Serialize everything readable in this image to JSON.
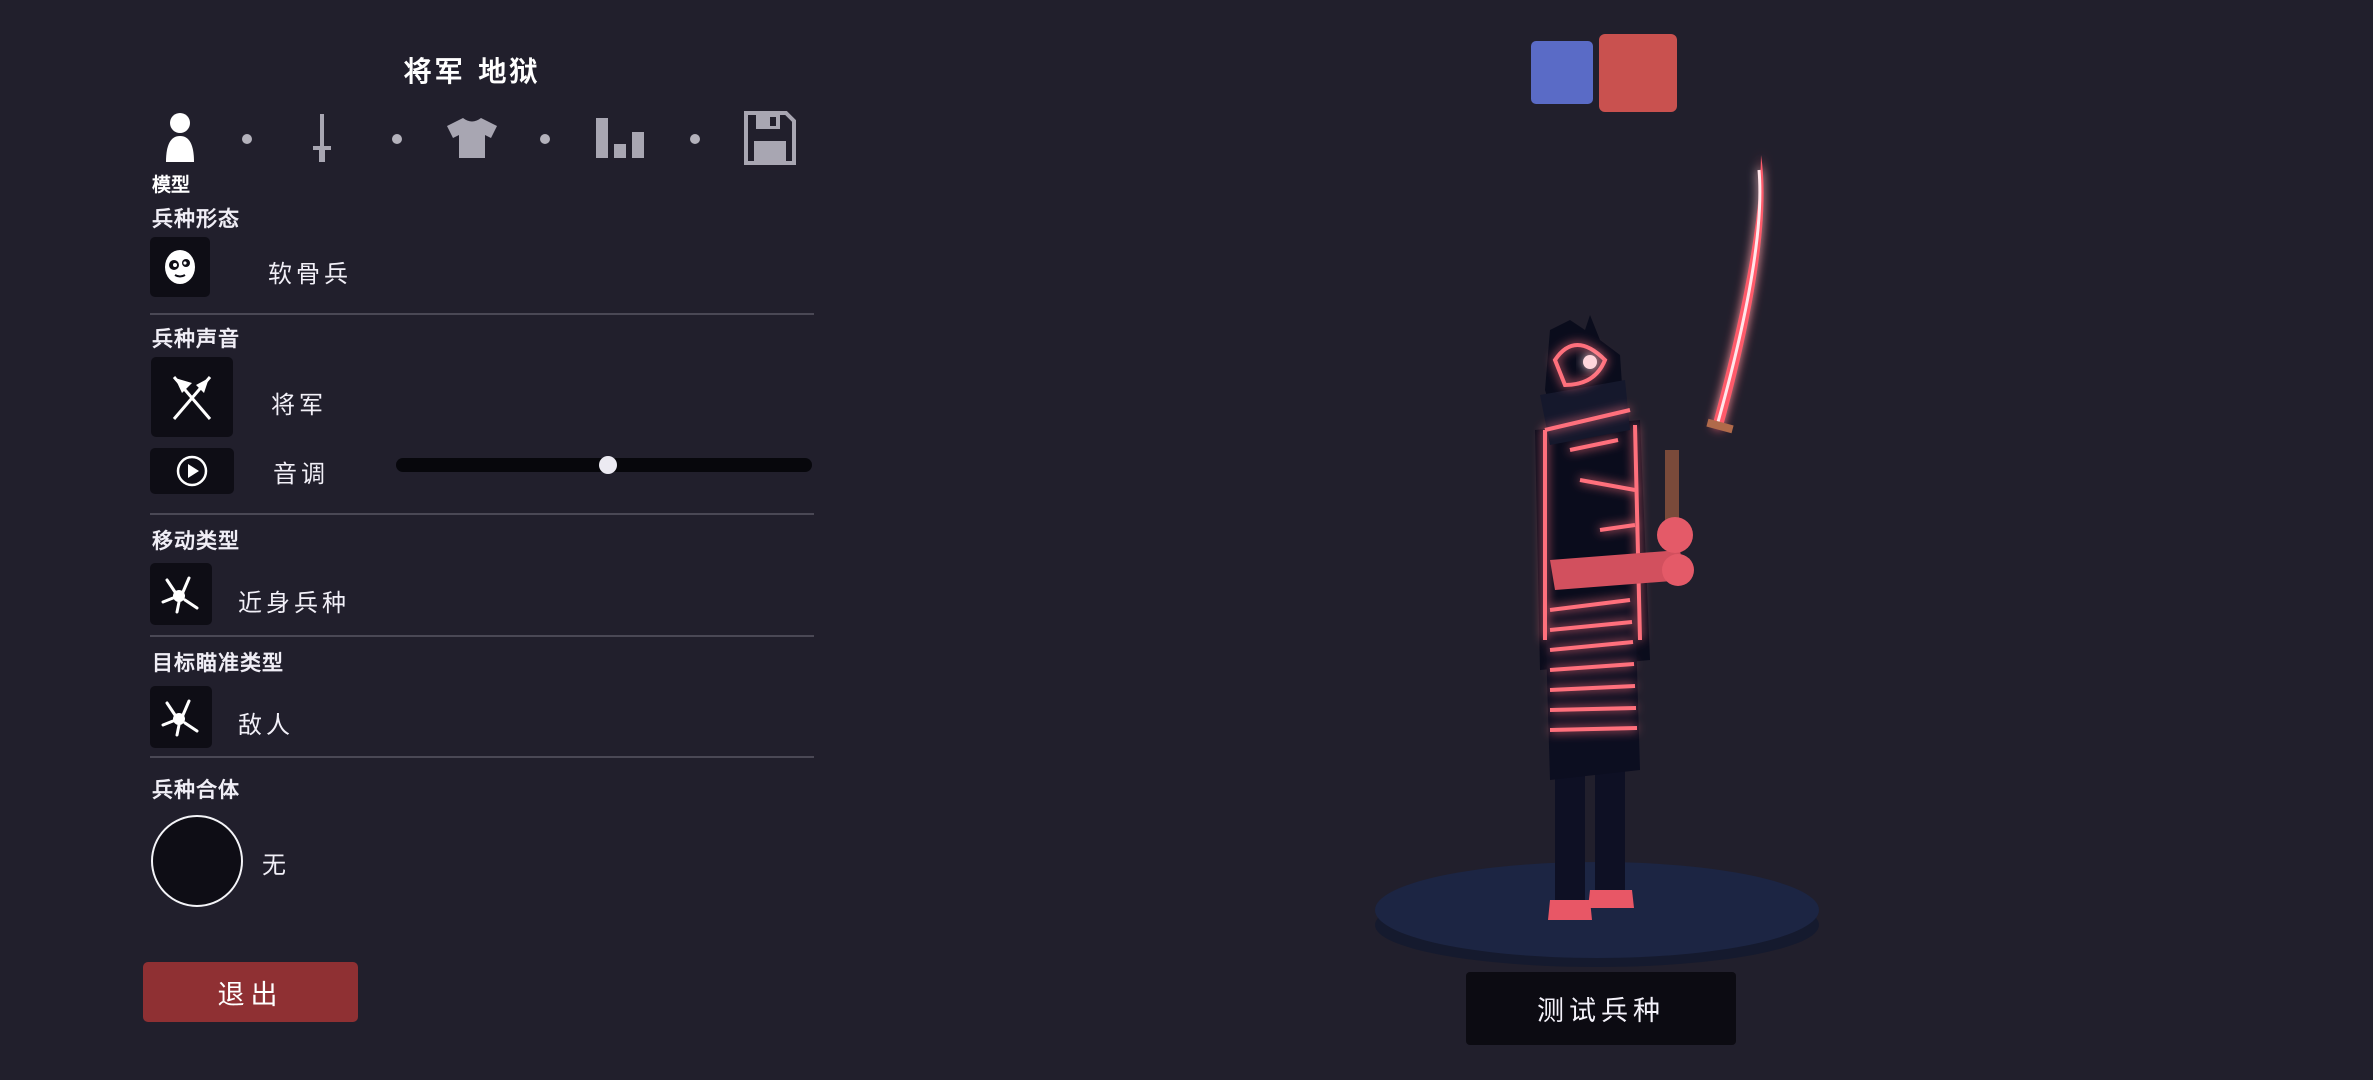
{
  "header": {
    "title": "将军 地狱"
  },
  "tabs": {
    "items": [
      {
        "icon": "person-icon",
        "active": true
      },
      {
        "icon": "sword-icon",
        "active": false
      },
      {
        "icon": "shirt-icon",
        "active": false
      },
      {
        "icon": "stats-bars-icon",
        "active": false
      },
      {
        "icon": "save-floppy-icon",
        "active": false
      }
    ],
    "active_label": "模型"
  },
  "sections": {
    "form": {
      "label": "兵种形态",
      "value": "软骨兵",
      "icon": "ragdoll-face-icon"
    },
    "voice": {
      "label": "兵种声音",
      "value": "将军",
      "icon": "crossed-flags-icon",
      "pitch_label": "音调",
      "pitch_value": 0.51,
      "play_icon": "play-circle-icon"
    },
    "movement": {
      "label": "移动类型",
      "value": "近身兵种",
      "icon": "melee-unit-icon"
    },
    "targeting": {
      "label": "目标瞄准类型",
      "value": "敌人",
      "icon": "target-unit-icon"
    },
    "combine": {
      "label": "兵种合体",
      "value": "无"
    }
  },
  "buttons": {
    "exit": "退出",
    "test_unit": "测试兵种"
  },
  "teams": {
    "blue_color": "#5a6bc6",
    "red_color": "#c9514f",
    "selected": "red"
  },
  "colors": {
    "background": "#211f2c",
    "panel_box": "#0e0d15",
    "exit": "#8f3033",
    "glow": "#ff3b4e"
  }
}
